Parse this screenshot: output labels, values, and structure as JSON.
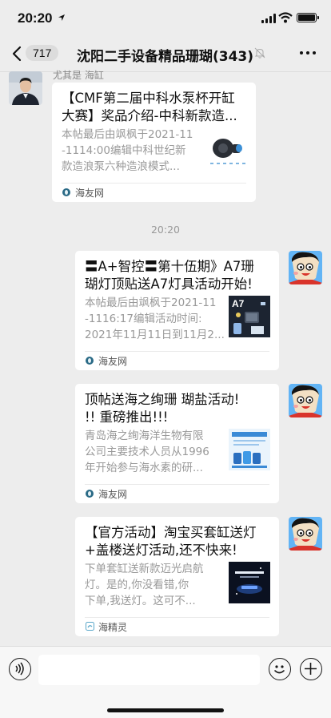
{
  "status": {
    "time": "20:20"
  },
  "nav": {
    "back_count": "717",
    "title": "沈阳二手设备精品珊瑚(343)"
  },
  "messages": [
    {
      "sender": "尤其是 海缸",
      "title_lines": [
        "【CMF第二届中科水泵杯开缸",
        "大赛】奖品介绍-中科新款造..."
      ],
      "desc_lines": [
        "本帖最后由飒枫于2021-11",
        "-1114:00编辑中科世纪新",
        "款造浪泵六种造浪模式..."
      ],
      "source": "海友网",
      "thumb_icon": "wave-pump-product-image"
    },
    {
      "title_lines": [
        "〓A+智控〓第十伍期》A7珊",
        "瑚灯顶贴送A7灯具活动开始!"
      ],
      "desc_lines": [
        "本帖最后由飒枫于2021-11",
        "-1116:17编辑活动时间:",
        "2021年11月11日到11月2..."
      ],
      "source": "海友网",
      "thumb_label": "A7"
    },
    {
      "title_lines": [
        "顶帖送海之绚珊 瑚盐活动!",
        "!! 重磅推出!!!"
      ],
      "desc_lines": [
        "青岛海之绚海洋生物有限",
        "公司主要技术人员从1996",
        "年开始参与海水素的研..."
      ],
      "source": "海友网",
      "thumb_icon": "reef-salt-poster-image"
    },
    {
      "title_lines": [
        "【官方活动】淘宝买套缸送灯",
        "+盖楼送灯活动,还不快来!"
      ],
      "desc_lines": [
        "下单套缸送新款迈光启航",
        "灯。是的,你没看错,你",
        "下单,我送灯。这可不..."
      ],
      "source": "海精灵",
      "thumb_icon": "dark-promo-poster-image"
    }
  ],
  "time_separator": "20:20",
  "colors": {
    "background": "#ededed",
    "card": "#ffffff",
    "source_icon": "#2a6a86"
  }
}
